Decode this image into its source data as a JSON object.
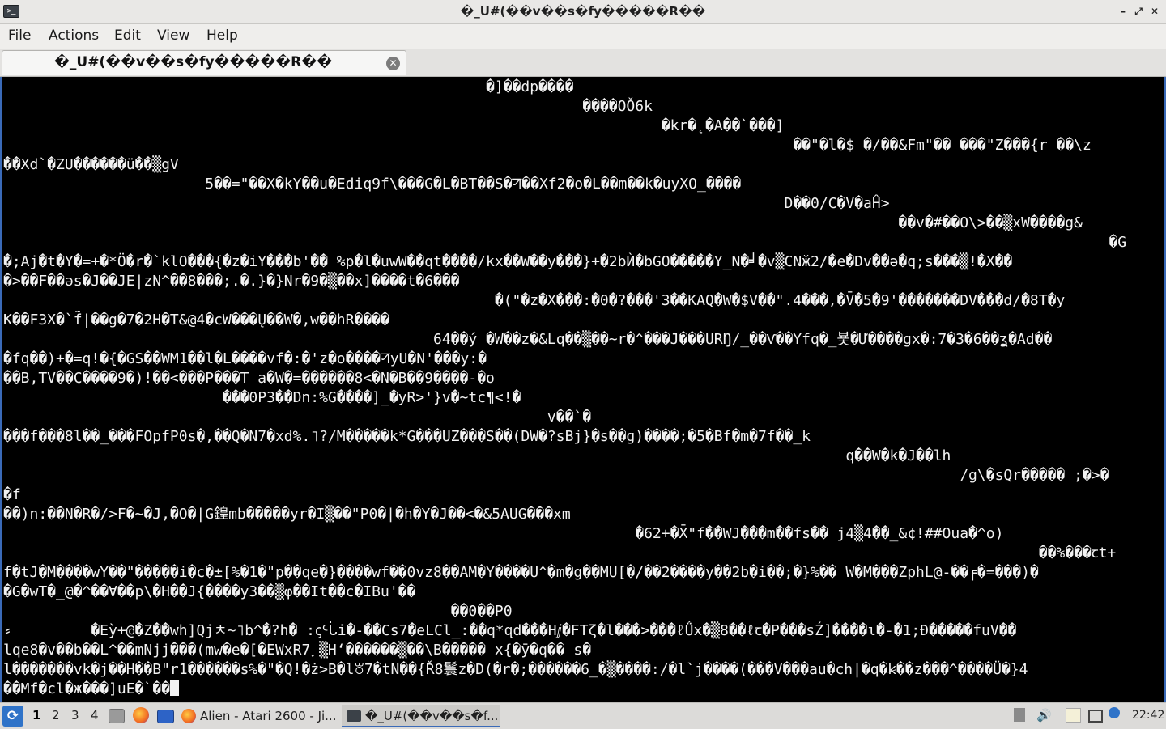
{
  "window": {
    "title": "�_U#(��v��s�fy�����R��",
    "minimize_glyph": "–",
    "maximize_glyph": "⤢",
    "close_glyph": "✕",
    "icon": "terminal-icon"
  },
  "menu": [
    "File",
    "Actions",
    "Edit",
    "View",
    "Help"
  ],
  "tab": {
    "label": "�_U#(��v��s�fy�����R��",
    "close_glyph": "✕"
  },
  "terminal": {
    "lines": [
      "                                                       �]��dp����",
      "                                                                  ����OǑ6k",
      "                                                                           �kr�˛�A��`���]",
      "                                                                                          ��\"�l�$ �/��&Fm\"�� ���\"Z���{r ��\\z",
      "��Xd`�ZU������ü��▒gV",
      "                       5��=\"��X�kY��u�Ediq9f\\���G�L�BT��S�ꠞ��Xf2�o�L��m��k�uyXO_����",
      "                                                                                         D��0/C�V�aĤ>",
      "                                                                                                      ��v�#��O\\>��▒xW����g&",
      "                                                                                                                              �G",
      "�;Aj�t�Y�=+�*Ö�r�`klO���{�z�iY���b'�� %p�l�uwW��qt����/kx��W��y���}+�2bЍ�bGO�����Y_N�╛�v▒CNӂ2/�e�Dv��ə�q;s���▒!�X��",
      "�>��F��əs�J��JE|zN^��8���;.�.}�}Nr�9�▒��x]����t�6���",
      "                                                        �(\"�z�X���:�0�?���'3��KAQ�W�$V��\".4���,�V̄�5�9'�������DV���d/�8T�y",
      "K��F3X�`f̃|��g�7�2H�T&@4�cW���Ų��W�,w��hR����",
      "                                                 64��ý �W��z�&Lq��▒��~r�^���J���URŊ/_��Ѵ��Yfq�_뵻�Ư����gx�:7�3�6��ʓ�Ad��",
      "�fq��)+�=q!�{�GS��WM1��l�L����vf�:�'z�o����ꠞyU�N'���y:�",
      "��B,TV��C����9�)!��<���P���T a�W�=������8<�N�B��9����-�o",
      "                         ���0P3��Dn:%G����]_�yR>'}v�~tc¶<!�",
      "                                                              v��`�",
      "���f���8l��_���FOpfP0s�,��Q�N7�xd%.˥?/M�����k*G���UZ���S��(DW�?sBj}�s��g)����;�5�Bf�m�7f��_k",
      "                                                                                                q��W�k�J��lh",
      "                                                                                                             /g\\�sQr����� ;�>�",
      "�f",
      "��)n:��N�R�/>F�~�J,�O�|G鍠mb�����yr�I▒��\"P0�|�h�Y�J��<�&5AUG���xm",
      "                                                                        �62+�X̄\"f��WJ���m��fs�� j4▒4��_&¢!##Oua�^o)",
      "                                                                                                                      ��%���ꞇt+",
      "f�tJ�M����wY��\"�����i�c�±[%�1�\"p��qe�}����wf��0vz8��AM�Y����U^�m�g��MU[�/��2����y��2b�i��;�}%�� W�M���ZphL@-��╒�=���)�",
      "�G�wT�_@�^��Ɐ��p\\�H��J{����y3��▒φ��It��c�IBu'��",
      "                                                   ��0��P0",
      "⸗         �Eỳ+@�Z��wh]Qjㅊ~˥b^�?h� :ꞔᑦᒑi�-��Cs7�eLCl̲:��q*ɋd���Hⅉ�FTζ�l���>���ℓǗx�▒8��ℓꞇ�P���sŹ]����ɩ�-�1;Ð�����fuV��",
      "lqe8�v��b��L^��mNjj���(mw�e�[�EWxR7˯▒H‘������▒��\\B����� x{�ӯ�q�� s�",
      "l�������vk�j��H��B\"r1������s%�\"�Q!�ż>B�l꘠7�tN��{Ř8鬟z�D(�r�;������6_�▒����:/�l`j����(���V���au�ch|�q�ꞣ��z���^����Ü�}4",
      "��Mf�cl�ж���]uE�`��"
    ]
  },
  "taskbar": {
    "start_icon": "lxqt-menu-icon",
    "workspaces": [
      "1",
      "2",
      "3",
      "4"
    ],
    "launchers": [
      "file-manager-icon",
      "firefox-icon",
      "show-desktop-icon"
    ],
    "tasks": [
      {
        "label": "Alien - Atari 2600 - Ji...",
        "icon": "firefox-icon"
      },
      {
        "label": "�_U#(��v��s�f...",
        "icon": "terminal-icon"
      }
    ],
    "tray_icons": [
      "updates-icon",
      "volume-icon",
      "clipboard-icon",
      "network-icon",
      "notification-icon"
    ],
    "clock": "22:42"
  }
}
